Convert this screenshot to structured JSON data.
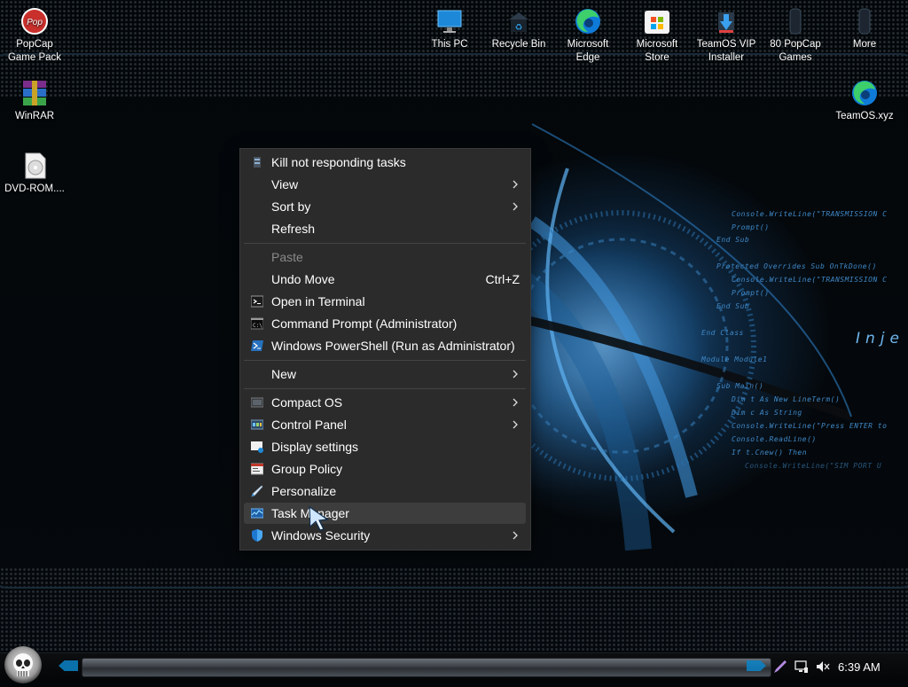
{
  "desktop_icons": [
    {
      "name": "popcap-icon",
      "label": "PopCap\nGame Pack"
    },
    {
      "name": "winrar-icon",
      "label": "WinRAR"
    },
    {
      "name": "dvd-rom-icon",
      "label": "DVD-ROM...."
    },
    {
      "name": "this-pc-icon",
      "label": "This PC"
    },
    {
      "name": "recycle-bin-icon",
      "label": "Recycle Bin"
    },
    {
      "name": "edge-icon",
      "label": "Microsoft\nEdge"
    },
    {
      "name": "store-icon",
      "label": "Microsoft\nStore"
    },
    {
      "name": "teamos-installer-icon",
      "label": "TeamOS VIP\nInstaller"
    },
    {
      "name": "popcap-games-icon",
      "label": "80 PopCap\nGames"
    },
    {
      "name": "more-icon",
      "label": "More"
    },
    {
      "name": "teamos-xyz-icon",
      "label": "TeamOS.xyz"
    }
  ],
  "context_menu": {
    "items": [
      {
        "label": "Kill not responding tasks",
        "icon": "kill-tasks-icon"
      },
      {
        "label": "View",
        "submenu": true
      },
      {
        "label": "Sort by",
        "submenu": true
      },
      {
        "label": "Refresh"
      },
      {
        "label": "Paste",
        "disabled": true
      },
      {
        "label": "Undo Move",
        "shortcut": "Ctrl+Z"
      },
      {
        "label": "Open in Terminal",
        "icon": "terminal-icon"
      },
      {
        "label": "Command Prompt (Administrator)",
        "icon": "cmd-icon"
      },
      {
        "label": "Windows PowerShell (Run as Administrator)",
        "icon": "powershell-icon"
      },
      {
        "label": "New",
        "submenu": true
      },
      {
        "label": "Compact OS",
        "icon": "compact-os-icon",
        "submenu": true
      },
      {
        "label": "Control Panel",
        "icon": "control-panel-icon",
        "submenu": true
      },
      {
        "label": "Display settings",
        "icon": "display-settings-icon"
      },
      {
        "label": "Group Policy",
        "icon": "group-policy-icon"
      },
      {
        "label": "Personalize",
        "icon": "personalize-icon"
      },
      {
        "label": "Task Manager",
        "icon": "task-manager-icon",
        "highlighted": true
      },
      {
        "label": "Windows Security",
        "icon": "windows-security-icon",
        "submenu": true
      }
    ]
  },
  "wallpaper_code": [
    "Console.WriteLine(\"TRANSMISSION C",
    "Prompt()",
    "End Sub",
    "Protected Overrides Sub OnTkDone()",
    "Console.WriteLine(\"TRANSMISSION C",
    "Prompt()",
    "End Sub",
    "End Class",
    "Module Module1",
    "Sub Main()",
    "Dim t As New LineTerm()",
    "Dim c As String",
    "Console.WriteLine(\"Press ENTER to",
    "Console.ReadLine()",
    "If t.Cnew() Then",
    "Console.WriteLine(\"SIM PORT U"
  ],
  "wallpaper_text": "Inje",
  "taskbar": {
    "clock": "6:39 AM",
    "tray_icons": [
      "pen-icon",
      "network-icon",
      "volume-muted-icon"
    ]
  },
  "colors": {
    "menu_bg": "#2b2b2b",
    "menu_highlight": "#3d3d3d",
    "accent_blue": "#0a84c8"
  }
}
